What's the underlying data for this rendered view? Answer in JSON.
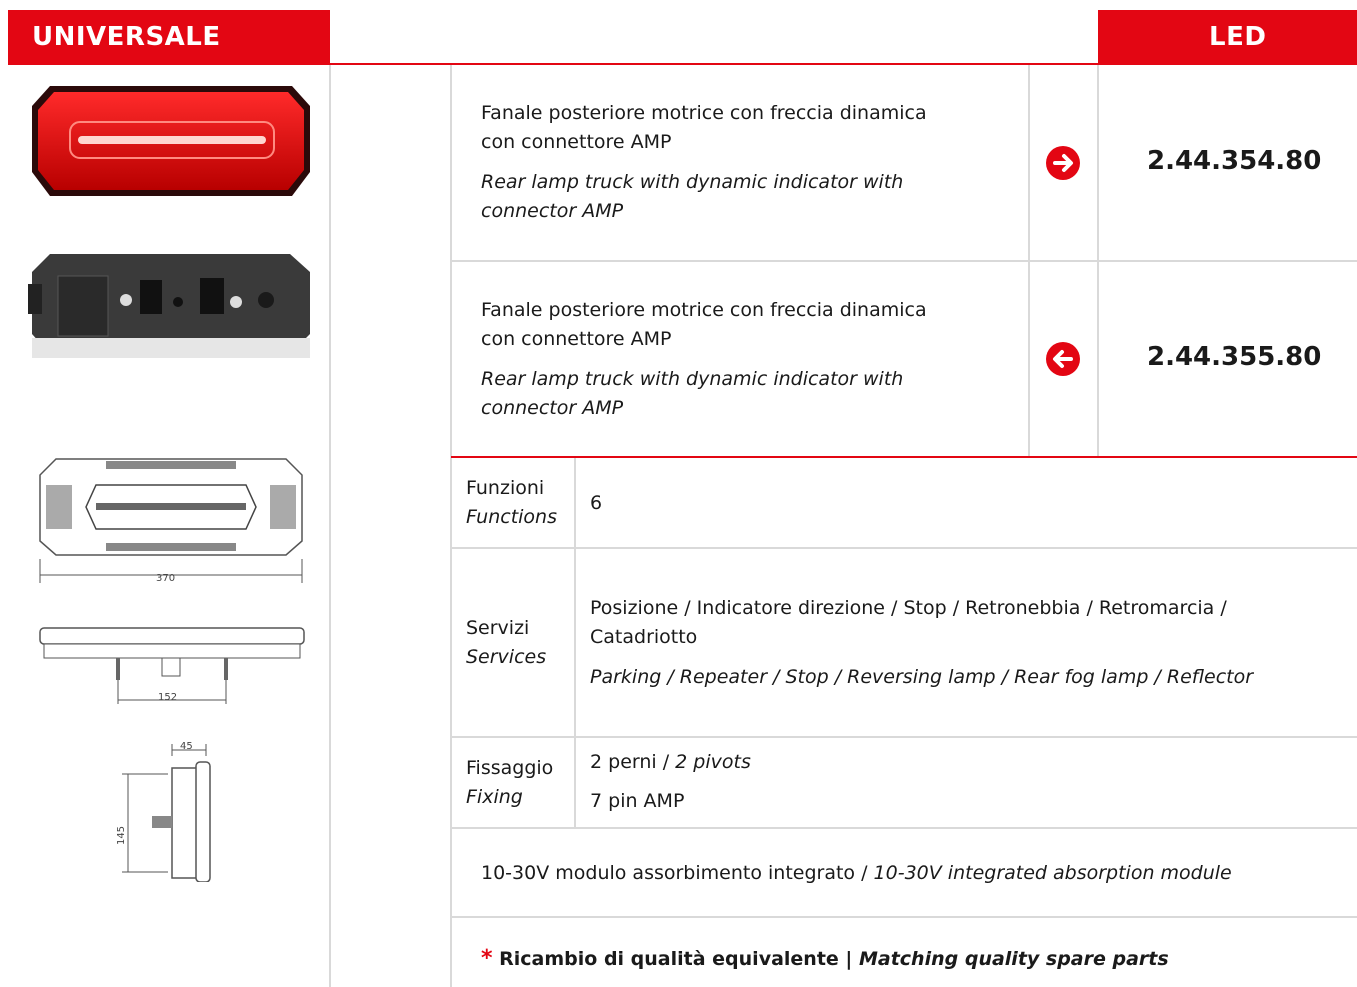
{
  "header": {
    "left_label": "UNIVERSALE",
    "right_label": "LED"
  },
  "products": [
    {
      "desc_it_1": "Fanale posteriore motrice con freccia dinamica",
      "desc_it_2": "con connettore AMP",
      "desc_en_1": "Rear lamp truck with dynamic indicator with",
      "desc_en_2": "connector AMP",
      "side_icon": "arrow-right-icon",
      "code": "2.44.354.80"
    },
    {
      "desc_it_1": "Fanale posteriore motrice con freccia dinamica",
      "desc_it_2": "con connettore AMP",
      "desc_en_1": "Rear lamp truck with dynamic indicator with",
      "desc_en_2": "connector AMP",
      "side_icon": "arrow-left-icon",
      "code": "2.44.355.80"
    }
  ],
  "specs": {
    "functions": {
      "label_it": "Funzioni",
      "label_en": "Functions",
      "value": "6"
    },
    "services": {
      "label_it": "Servizi",
      "label_en": "Services",
      "value_it_1": "Posizione / Indicatore direzione / Stop / Retronebbia / Retromarcia /",
      "value_it_2": "Catadriotto",
      "value_en": "Parking / Repeater / Stop / Reversing lamp / Rear fog lamp / Reflector"
    },
    "fixing": {
      "label_it": "Fissaggio",
      "label_en": "Fixing",
      "line1_it": "2 perni /",
      "line1_en": "2 pivots",
      "line2": "7 pin AMP"
    }
  },
  "note": {
    "it": "10-30V modulo assorbimento integrato /",
    "en": "10-30V integrated absorption module"
  },
  "footer": {
    "star": "*",
    "it": "Ricambio di qualità equivalente |",
    "en": "Matching quality spare parts"
  },
  "drawings": {
    "width_dim": "370",
    "pivot_dim": "152",
    "depth_dim": "45",
    "height_dim": "145"
  },
  "colors": {
    "accent": "#e30613",
    "divider": "#d9d9d9"
  }
}
